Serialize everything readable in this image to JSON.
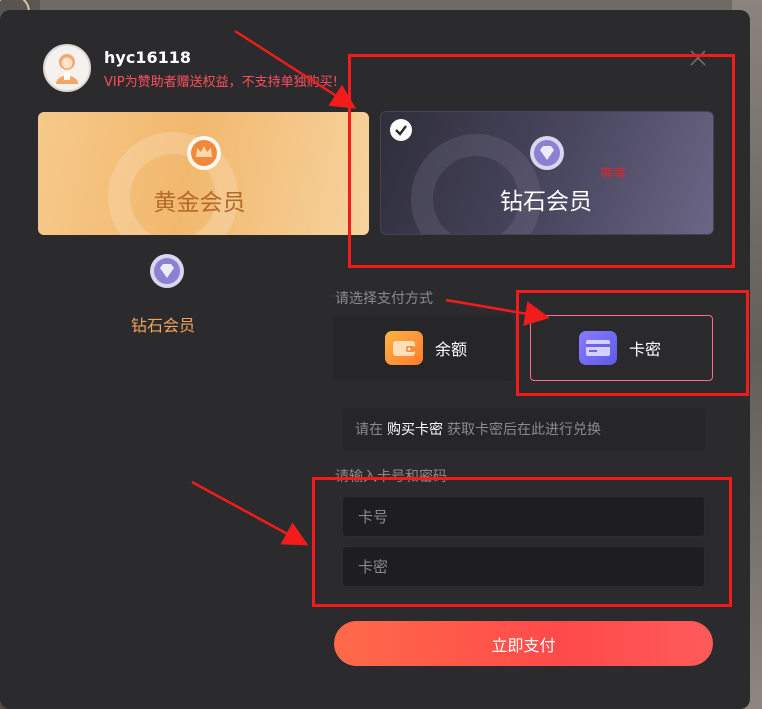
{
  "user": {
    "name": "hyc16118",
    "notice": "VIP为赞助者赠送权益，不支持单独购买!"
  },
  "cards": {
    "gold_label": "黄金会员",
    "diamond_label": "钻石会员",
    "diamond_tag": "等等"
  },
  "side": {
    "label": "钻石会员"
  },
  "payment": {
    "section_label": "请选择支付方式",
    "balance_label": "余额",
    "card_label": "卡密"
  },
  "info": {
    "prefix": "请在",
    "link": "购买卡密",
    "suffix": "获取卡密后在此进行兑换"
  },
  "form": {
    "section_label": "请输入卡号和密码",
    "card_no_placeholder": "卡号",
    "card_pwd_placeholder": "卡密",
    "card_no_value": "",
    "card_pwd_value": ""
  },
  "submit": {
    "label": "立即支付"
  },
  "colors": {
    "accent": "#ff4a4a",
    "notice": "#ff4d5e",
    "annotation": "#f21c1c",
    "gold": "#f2b86e",
    "diamond_medal": "#9b93d8"
  },
  "icons": [
    "avatar-icon",
    "close-icon",
    "crown-medal-icon",
    "diamond-medal-icon",
    "check-icon",
    "wallet-icon",
    "card-icon"
  ]
}
